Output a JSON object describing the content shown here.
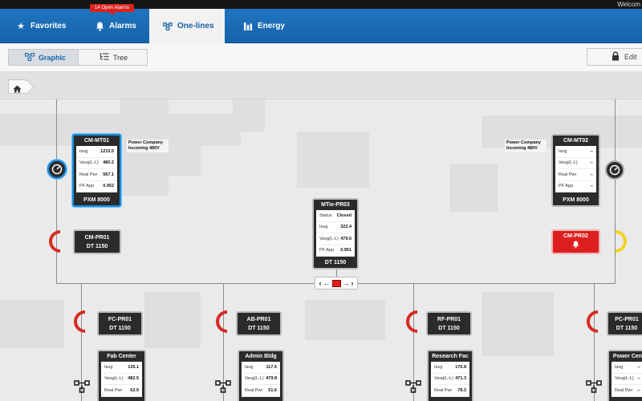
{
  "header": {
    "welcome": "Welcom"
  },
  "nav": {
    "tabs": [
      {
        "label": "Favorites",
        "icon": "star-icon"
      },
      {
        "label": "Alarms",
        "icon": "bell-icon"
      },
      {
        "label": "One-lines",
        "icon": "one-line-icon"
      },
      {
        "label": "Energy",
        "icon": "bar-chart-icon"
      }
    ],
    "alarm_badge": "14 Open Alarms",
    "active_tab": "One-lines"
  },
  "toolbar": {
    "view_graphic": "Graphic",
    "view_tree": "Tree",
    "edit_label": "Edit"
  },
  "diagram": {
    "main_meters": [
      {
        "title": "CM-MT01",
        "model": "PXM 8000",
        "note": "Power Company Incoming 480V",
        "rows": [
          {
            "label": "Iavg",
            "value": "1215.5"
          },
          {
            "label": "Vavg(L-L)",
            "value": "480.2"
          },
          {
            "label": "Real Pwr",
            "value": "567.1"
          },
          {
            "label": "PF App",
            "value": "0.952"
          }
        ]
      },
      {
        "title": "CM-MT02",
        "model": "PXM 8000",
        "note": "Power Company Incoming 480V",
        "rows": [
          {
            "label": "Iavg",
            "value": "--"
          },
          {
            "label": "Vavg(L-L)",
            "value": "--"
          },
          {
            "label": "Real Pwr",
            "value": "--"
          },
          {
            "label": "PF App",
            "value": "--"
          }
        ]
      }
    ],
    "tie": {
      "title": "MTie-PR03",
      "model": "DT 1150",
      "rows": [
        {
          "label": "Status",
          "value": "Closed"
        },
        {
          "label": "Iavg",
          "value": "322.4"
        },
        {
          "label": "Vavg(L-L)",
          "value": "479.6"
        },
        {
          "label": "PF App",
          "value": "0.951"
        }
      ]
    },
    "protectors": [
      {
        "name": "CM-PR01",
        "model": "DT 1150"
      },
      {
        "name": "CM-PR02",
        "model": ""
      },
      {
        "name": "FC-PR01",
        "model": "DT 1150"
      },
      {
        "name": "AB-PR01",
        "model": "DT 1150"
      },
      {
        "name": "RF-PR01",
        "model": "DT 1150"
      },
      {
        "name": "PC-PR01",
        "model": "DT 1150"
      }
    ],
    "feeders": [
      {
        "title": "Fab Center",
        "rows": [
          {
            "label": "Iavg",
            "value": "135.1"
          },
          {
            "label": "Vavg(L-L)",
            "value": "482.5"
          },
          {
            "label": "Real Pwr",
            "value": "62.9"
          }
        ]
      },
      {
        "title": "Admin Bldg",
        "rows": [
          {
            "label": "Iavg",
            "value": "117.5"
          },
          {
            "label": "Vavg(L-L)",
            "value": "479.8"
          },
          {
            "label": "Real Pwr",
            "value": "51.6"
          }
        ]
      },
      {
        "title": "Research Fac",
        "rows": [
          {
            "label": "Iavg",
            "value": "176.8"
          },
          {
            "label": "Vavg(L-L)",
            "value": "471.3"
          },
          {
            "label": "Real Pwr",
            "value": "78.3"
          }
        ]
      },
      {
        "title": "Power Cen",
        "rows": [
          {
            "label": "Iavg",
            "value": "--"
          },
          {
            "label": "Vavg(L-L)",
            "value": "--"
          },
          {
            "label": "Real Pwr",
            "value": "--"
          }
        ]
      }
    ]
  },
  "colors": {
    "nav": "#1f74bf",
    "alarm": "#dd1f1f",
    "selected": "#1c8fe0",
    "breaker_closed": "#d62b23",
    "breaker_open": "#f1d21e"
  }
}
